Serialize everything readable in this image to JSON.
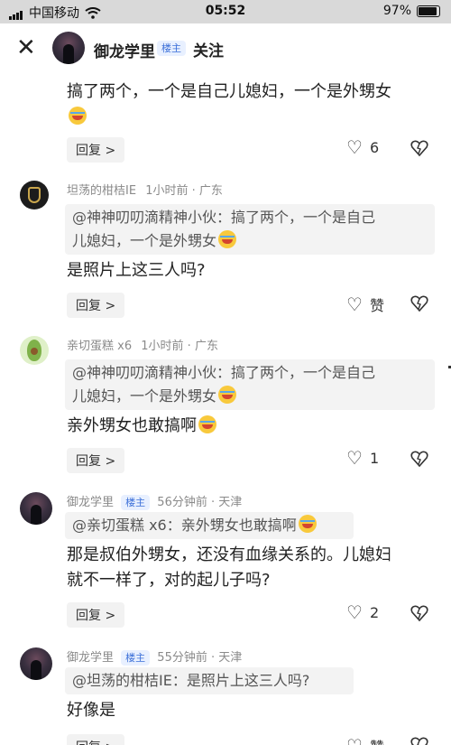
{
  "status": {
    "carrier": "中国移动",
    "time": "05:52",
    "battery": "97%"
  },
  "header": {
    "close_icon": "close-icon",
    "name": "御龙学里",
    "tag": "楼主",
    "follow": "关注"
  },
  "comments": [
    {
      "body_line1": "搞了两个，一个是自己儿媳妇，一个是外甥女",
      "reply": "回复",
      "likes": "6"
    },
    {
      "user": "坦荡的柑桔IE",
      "time": "1小时前",
      "location": "广东",
      "quote_line1": "@神神叨叨滴精神小伙：搞了两个，一个是自己",
      "quote_line2": "儿媳妇，一个是外甥女",
      "body": "是照片上这三人吗?",
      "reply": "回复",
      "likes": "赞"
    },
    {
      "user": "亲切蛋糕 x6",
      "time": "1小时前",
      "location": "广东",
      "quote_line1": "@神神叨叨滴精神小伙：搞了两个，一个是自己",
      "quote_line2": "儿媳妇，一个是外甥女",
      "body": "亲外甥女也敢搞啊",
      "reply": "回复",
      "likes": "1"
    },
    {
      "user": "御龙学里",
      "tag": "楼主",
      "time": "56分钟前",
      "location": "天津",
      "quote_line1": "@亲切蛋糕 x6：亲外甥女也敢搞啊",
      "body_line1": "那是叔伯外甥女，还没有血缘关系的。儿媳妇",
      "body_line2": "就不一样了，对的起儿子吗?",
      "reply": "回复",
      "likes": "2"
    },
    {
      "user": "御龙学里",
      "tag": "楼主",
      "time": "55分钟前",
      "location": "天津",
      "quote_line1": "@坦荡的柑桔IE：是照片上这三人吗?",
      "body": "好像是",
      "reply": "回复",
      "likes": "赞"
    }
  ],
  "separator": "·",
  "reply_chevron": ">"
}
